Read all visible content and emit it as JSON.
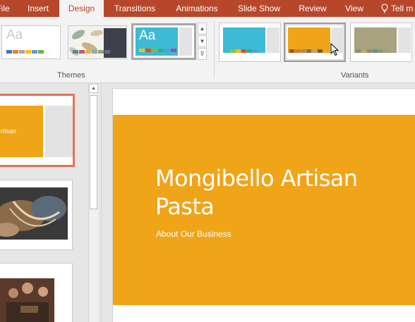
{
  "tabs": [
    {
      "label": "File"
    },
    {
      "label": "Insert"
    },
    {
      "label": "Design"
    },
    {
      "label": "Transitions"
    },
    {
      "label": "Animations"
    },
    {
      "label": "Slide Show"
    },
    {
      "label": "Review"
    },
    {
      "label": "View"
    },
    {
      "label": "Tell m"
    }
  ],
  "ribbon": {
    "themes_label": "Themes",
    "variants_label": "Variants",
    "theme_thumbs": [
      {
        "aa": "Aa",
        "swatches": [
          "#4472c4",
          "#ed7d31",
          "#a5a5a5",
          "#ffc000",
          "#5b9bd5",
          "#70ad47"
        ]
      },
      {
        "aa": "",
        "swatches": [
          "#6d8a6a",
          "#b5655c",
          "#e0b24a",
          "#89a8c4",
          "#96a06c",
          "#5f6d8a"
        ]
      },
      {
        "aa": "Aa",
        "swatches": [
          "#f5c216",
          "#e54b22",
          "#8bb43d",
          "#26b08b",
          "#5a9bd4",
          "#9e4ea8"
        ]
      }
    ],
    "variants": [
      {
        "band": "#3cbad6",
        "swatches": [
          "#3cbad6",
          "#8cc63f",
          "#f5c216",
          "#e54b22",
          "#26b08b",
          "#5a9bd4"
        ]
      },
      {
        "band": "#f0a417",
        "swatches": [
          "#a0522d",
          "#c97a3a",
          "#b5865a",
          "#8b6b4a",
          "#c0a070",
          "#7a5a3a"
        ]
      },
      {
        "band": "#a8a27e",
        "swatches": [
          "#7a9a6a",
          "#b8a96a",
          "#9a8a6a",
          "#6a8a9a",
          "#8a9a6a",
          "#aa9a7a"
        ]
      }
    ],
    "scroll": {
      "up": "▲",
      "down": "▼",
      "more": "⊽"
    }
  },
  "panel": {
    "slide1_text": "rtisan",
    "scroll_up": "▲"
  },
  "slide": {
    "title": "Mongibello Artisan Pasta",
    "subtitle": "About Our Business"
  },
  "colors": {
    "accent": "#b7472a",
    "slide_band": "#f0a417"
  }
}
